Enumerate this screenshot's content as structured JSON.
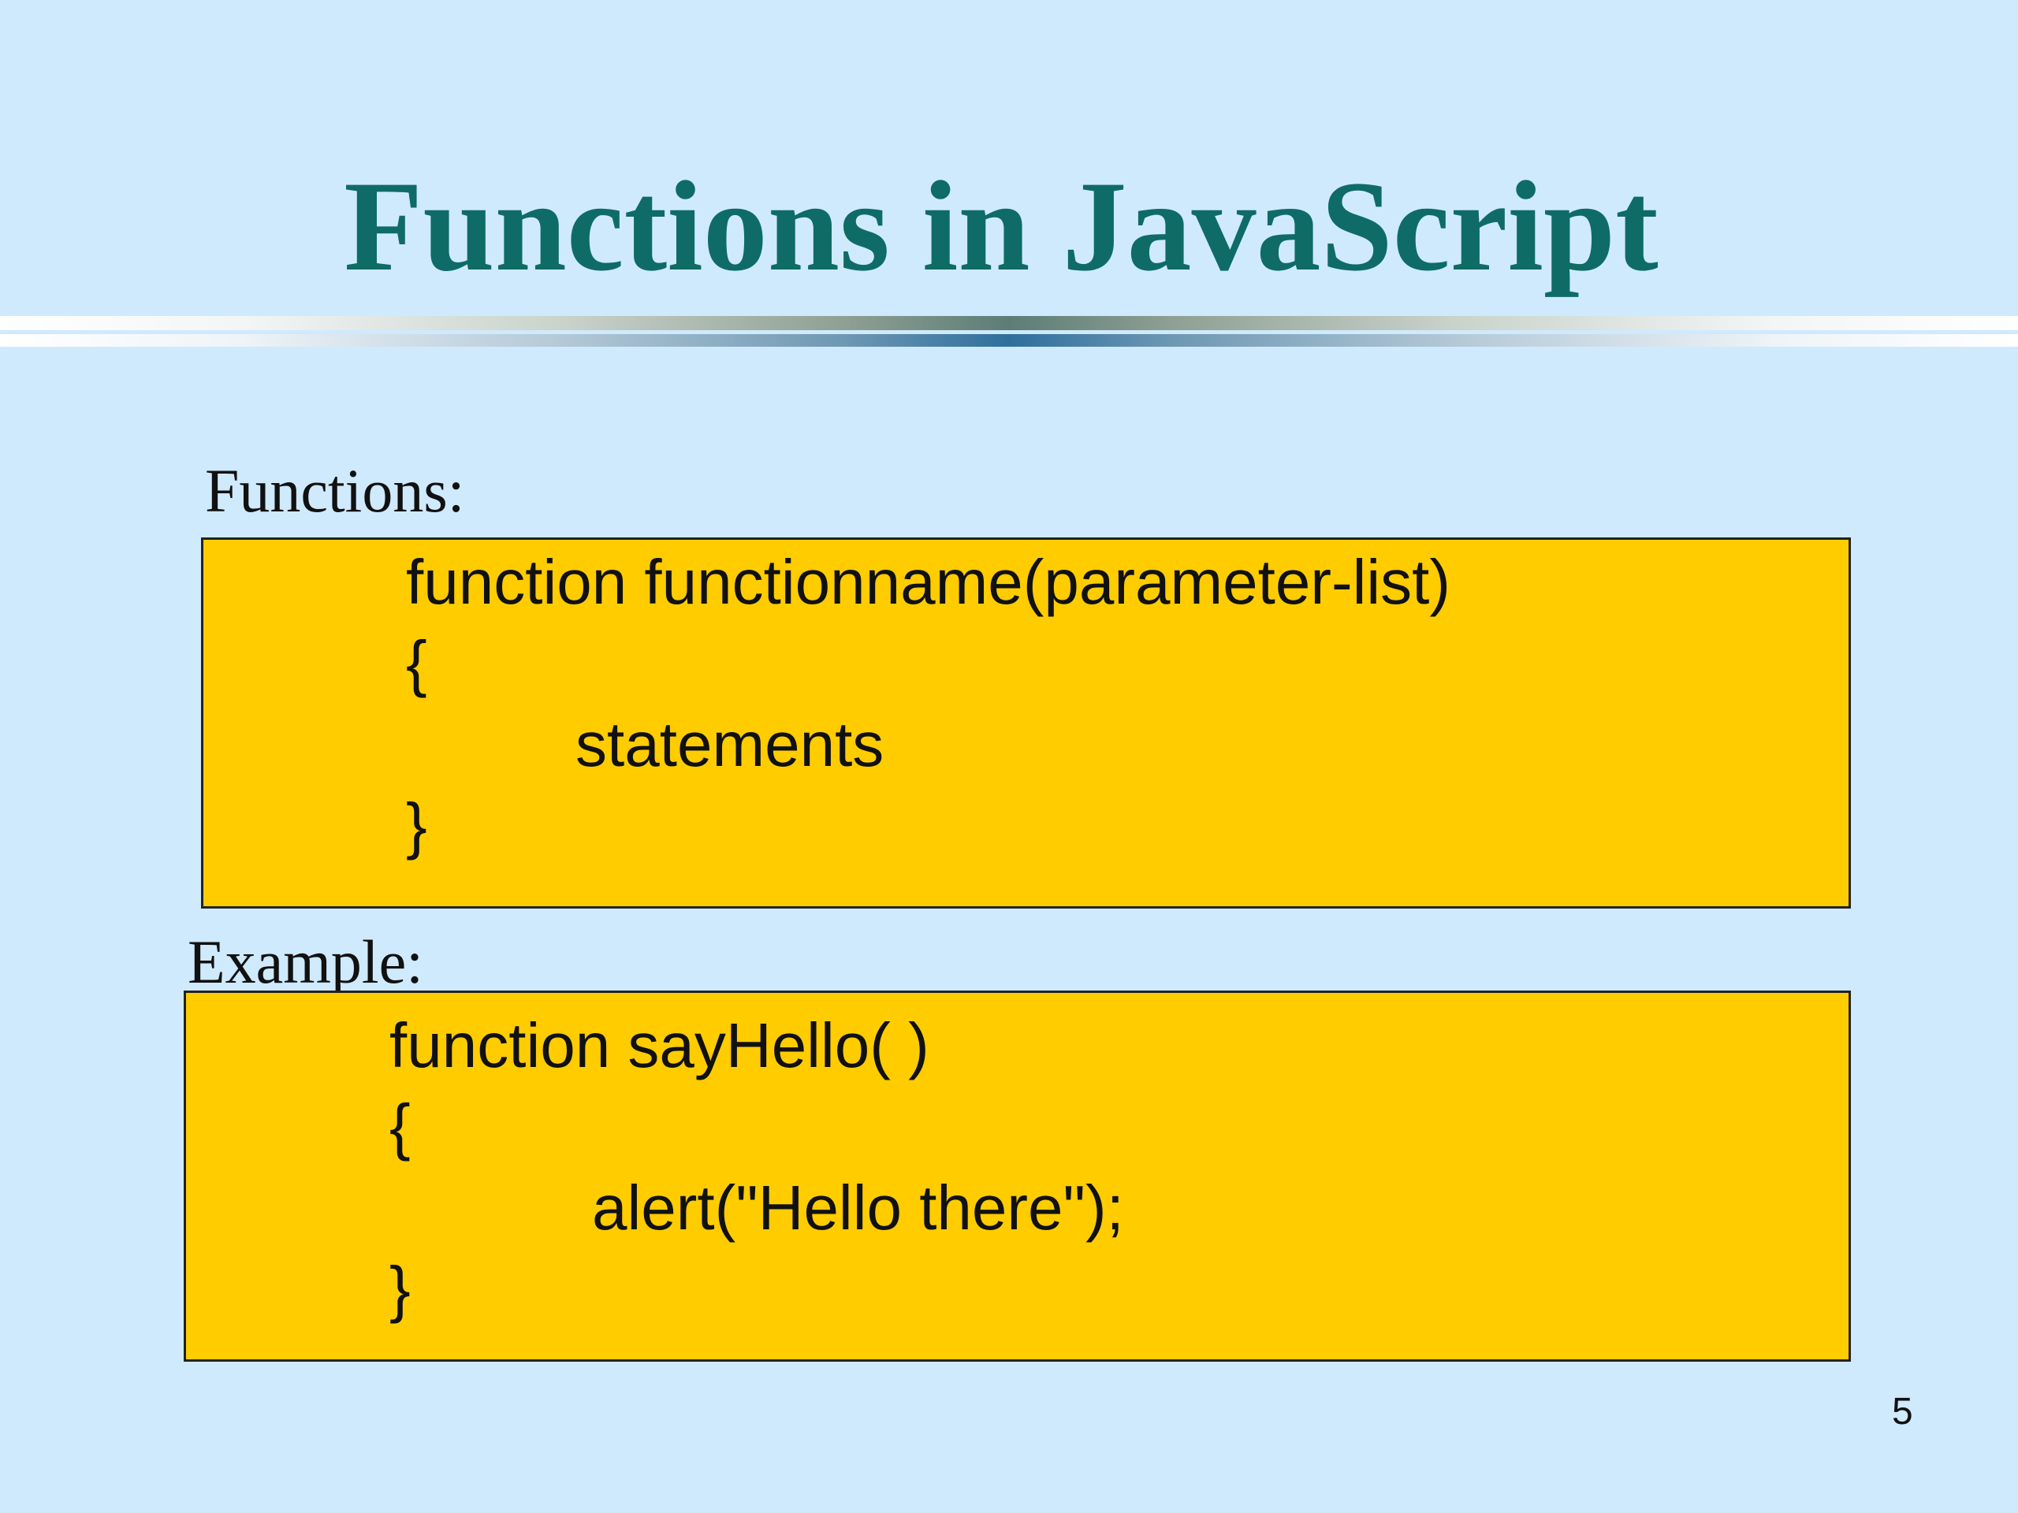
{
  "slide": {
    "title": "Functions in JavaScript",
    "page_number": "5"
  },
  "syntax": {
    "label": "Functions:",
    "lines": [
      "function functionname(parameter-list)",
      "{",
      "statements",
      "}"
    ]
  },
  "example": {
    "label": "Example:",
    "lines": [
      "function sayHello( )",
      "{",
      "alert(\"Hello there\");",
      "}"
    ]
  },
  "colors": {
    "background": "#cfeafd",
    "title": "#0f6b66",
    "code_box": "#ffcc00"
  }
}
